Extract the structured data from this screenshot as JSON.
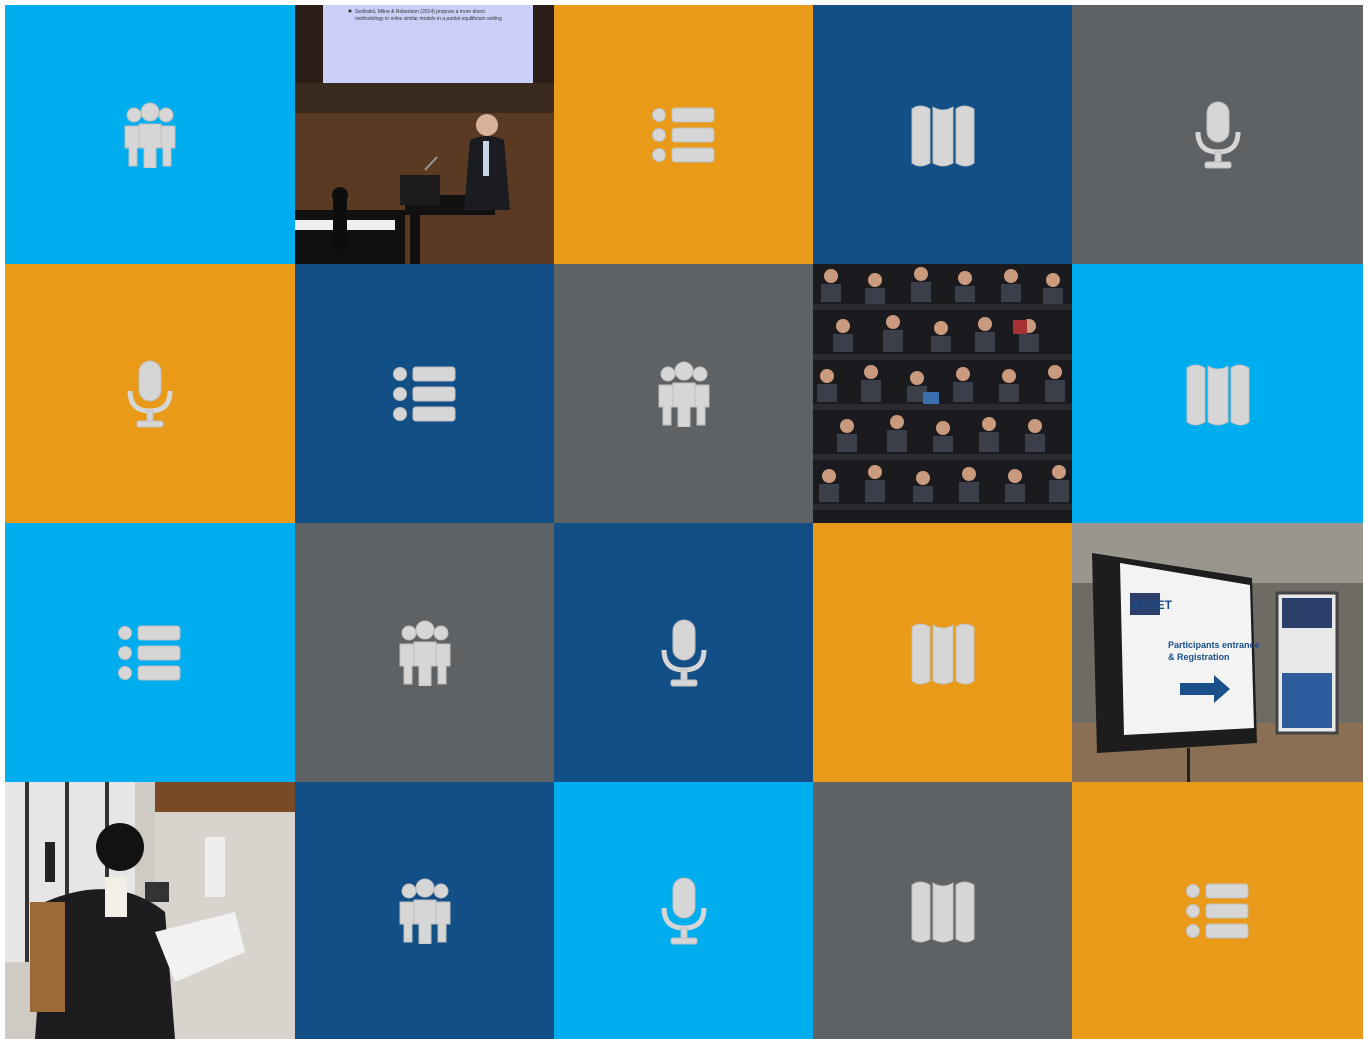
{
  "colors": {
    "cyan": "#00adef",
    "orange": "#e99a18",
    "navy": "#134f87",
    "gray": "#5f6265",
    "icon": "#d6d6d6"
  },
  "tiles": [
    {
      "kind": "icon",
      "icon": "people-icon",
      "color": "cyan"
    },
    {
      "kind": "photo",
      "photo": "speaker-at-podium-photo"
    },
    {
      "kind": "icon",
      "icon": "list-icon",
      "color": "orange"
    },
    {
      "kind": "icon",
      "icon": "map-icon",
      "color": "navy"
    },
    {
      "kind": "icon",
      "icon": "microphone-icon",
      "color": "gray"
    },
    {
      "kind": "icon",
      "icon": "microphone-icon",
      "color": "orange"
    },
    {
      "kind": "icon",
      "icon": "list-icon",
      "color": "navy"
    },
    {
      "kind": "icon",
      "icon": "people-icon",
      "color": "gray"
    },
    {
      "kind": "photo",
      "photo": "audience-photo"
    },
    {
      "kind": "icon",
      "icon": "map-icon",
      "color": "cyan"
    },
    {
      "kind": "icon",
      "icon": "list-icon",
      "color": "cyan"
    },
    {
      "kind": "icon",
      "icon": "people-icon",
      "color": "gray"
    },
    {
      "kind": "icon",
      "icon": "microphone-icon",
      "color": "navy"
    },
    {
      "kind": "icon",
      "icon": "map-icon",
      "color": "orange"
    },
    {
      "kind": "photo",
      "photo": "registration-sign-photo"
    },
    {
      "kind": "photo",
      "photo": "attendee-reading-photo"
    },
    {
      "kind": "icon",
      "icon": "people-icon",
      "color": "navy"
    },
    {
      "kind": "icon",
      "icon": "microphone-icon",
      "color": "cyan"
    },
    {
      "kind": "icon",
      "icon": "map-icon",
      "color": "gray"
    },
    {
      "kind": "icon",
      "icon": "list-icon",
      "color": "orange"
    }
  ],
  "photos": {
    "speaker_slide_line1": "Sedinskii, Milne & Robertson (2014) propose a more direct",
    "speaker_slide_line2": "methodology to solve similar models in a partial equilibrium setting",
    "sign_brand": "ASSET",
    "sign_line1": "Participants entrance",
    "sign_line2": "& Registration"
  }
}
